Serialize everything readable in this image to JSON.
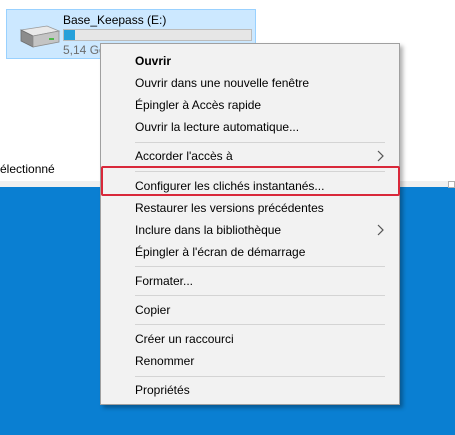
{
  "drive": {
    "name": "Base_Keepass (E:)",
    "size_text": "5,14 Go",
    "used_fraction": 0.06,
    "icon": "hard-drive-icon"
  },
  "status_text": "électionné",
  "colors": {
    "selection_bg": "#cce8ff",
    "desktop_blue": "#0a7fd2",
    "highlight_red": "#d9283a",
    "progress_fill": "#26a0da"
  },
  "context_menu": {
    "items": [
      {
        "label": "Ouvrir",
        "bold": true
      },
      {
        "label": "Ouvrir dans une nouvelle fenêtre"
      },
      {
        "label": "Épingler à Accès rapide"
      },
      {
        "label": "Ouvrir la lecture automatique..."
      },
      {
        "label": "Accorder l'accès à",
        "submenu": true
      },
      {
        "label": "Configurer les clichés instantanés...",
        "highlighted": true
      },
      {
        "label": "Restaurer les versions précédentes"
      },
      {
        "label": "Inclure dans la bibliothèque",
        "submenu": true
      },
      {
        "label": "Épingler à l'écran de démarrage"
      },
      {
        "label": "Formater..."
      },
      {
        "label": "Copier"
      },
      {
        "label": "Créer un raccourci"
      },
      {
        "label": "Renommer"
      },
      {
        "label": "Propriétés"
      }
    ]
  }
}
